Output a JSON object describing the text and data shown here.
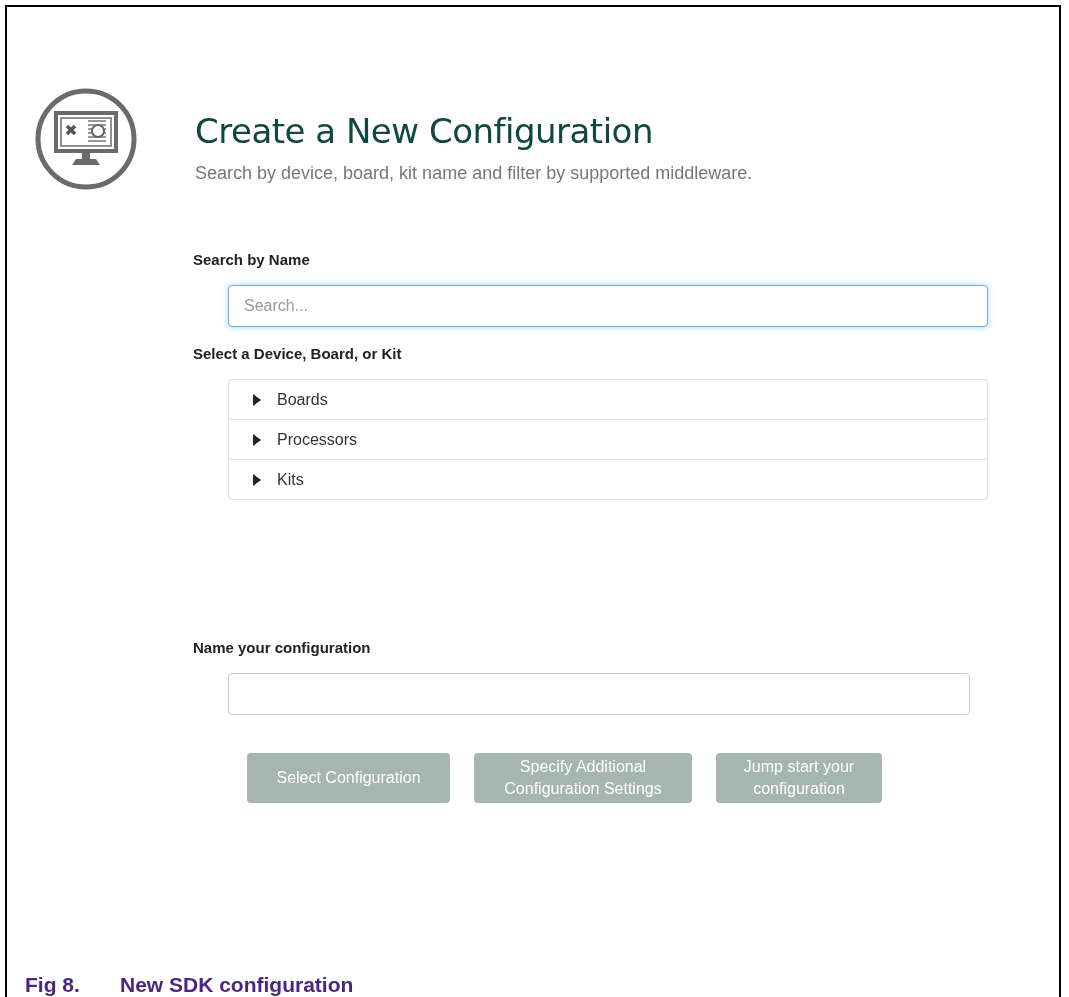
{
  "page": {
    "title": "Create a New Configuration",
    "subtitle": "Search by device, board, kit name and filter by supported middleware."
  },
  "search_section": {
    "label": "Search by Name",
    "search": {
      "placeholder": "Search...",
      "focused": true
    }
  },
  "select_section": {
    "label": "Select a Device, Board, or Kit",
    "items": [
      {
        "label": "Boards",
        "expanded": false
      },
      {
        "label": "Processors",
        "expanded": false
      },
      {
        "label": "Kits",
        "expanded": false
      }
    ]
  },
  "name_section": {
    "label": "Name your configuration"
  },
  "buttons": [
    {
      "label": "Select Configuration",
      "disabled": true
    },
    {
      "label": "Specify Additional Configuration Settings",
      "disabled": true
    },
    {
      "label": "Jump start your configuration",
      "disabled": true
    }
  ],
  "caption": {
    "number": "Fig 8.",
    "text": "New SDK configuration"
  }
}
